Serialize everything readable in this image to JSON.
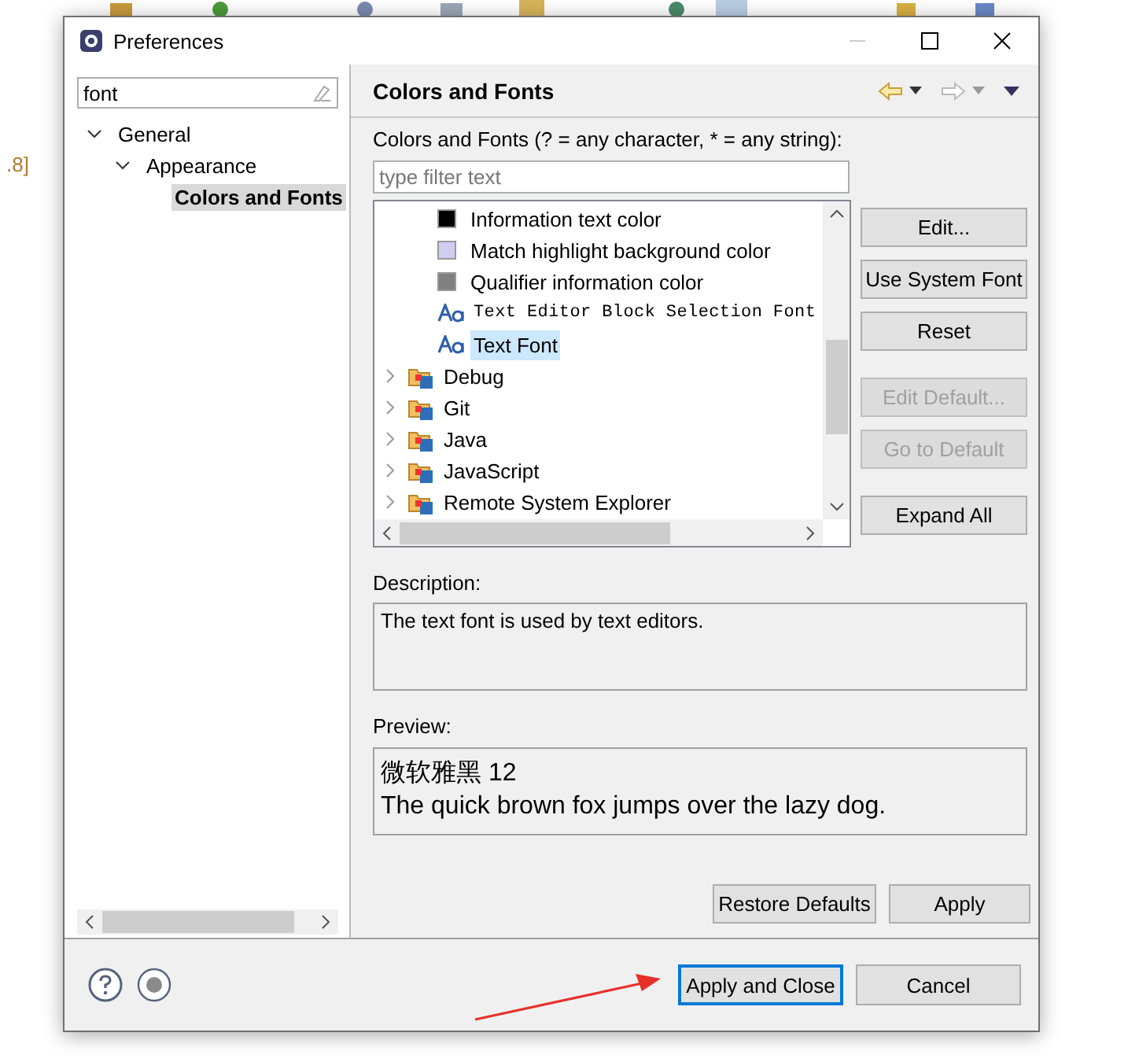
{
  "background": {
    "editor_fragment": ".8]"
  },
  "window": {
    "title": "Preferences"
  },
  "sidebar": {
    "search": {
      "value": "font"
    },
    "tree": [
      {
        "label": "General",
        "expanded": true,
        "selected": false,
        "children": [
          {
            "label": "Appearance",
            "expanded": true,
            "selected": false,
            "children": [
              {
                "label": "Colors and Fonts",
                "selected": true
              }
            ]
          }
        ]
      }
    ]
  },
  "page": {
    "title": "Colors and Fonts",
    "filter_label": "Colors and Fonts (? = any character, * = any string):",
    "filter": {
      "placeholder": "type filter text"
    },
    "entries": [
      {
        "kind": "color",
        "label": "Information text color",
        "color": "#000000",
        "selected": false
      },
      {
        "kind": "color",
        "label": "Match highlight background color",
        "color": "#cfcdf0",
        "selected": false
      },
      {
        "kind": "color",
        "label": "Qualifier information color",
        "color": "#808080",
        "selected": false
      },
      {
        "kind": "font",
        "label": "Text Editor Block Selection Font",
        "monospace": true,
        "selected": false
      },
      {
        "kind": "font",
        "label": "Text Font",
        "monospace": false,
        "selected": true
      },
      {
        "kind": "category",
        "label": "Debug",
        "selected": false
      },
      {
        "kind": "category",
        "label": "Git",
        "selected": false
      },
      {
        "kind": "category",
        "label": "Java",
        "selected": false
      },
      {
        "kind": "category",
        "label": "JavaScript",
        "selected": false
      },
      {
        "kind": "category",
        "label": "Remote System Explorer",
        "selected": false
      }
    ],
    "side_buttons": [
      {
        "label": "Edit...",
        "disabled": false
      },
      {
        "label": "Use System Font",
        "disabled": false
      },
      {
        "label": "Reset",
        "disabled": false
      },
      {
        "label": "Edit Default...",
        "disabled": true
      },
      {
        "label": "Go to Default",
        "disabled": true
      },
      {
        "label": "Expand All",
        "disabled": false
      }
    ],
    "description_label": "Description:",
    "description": "The text font is used by text editors.",
    "preview_label": "Preview:",
    "preview_lines": [
      "微软雅黑 12",
      "The quick brown fox jumps over the lazy dog."
    ],
    "buttons": [
      "Restore Defaults",
      "Apply"
    ]
  },
  "footer": {
    "buttons": [
      {
        "label": "Apply and Close",
        "default": true
      },
      {
        "label": "Cancel",
        "default": false
      }
    ]
  }
}
